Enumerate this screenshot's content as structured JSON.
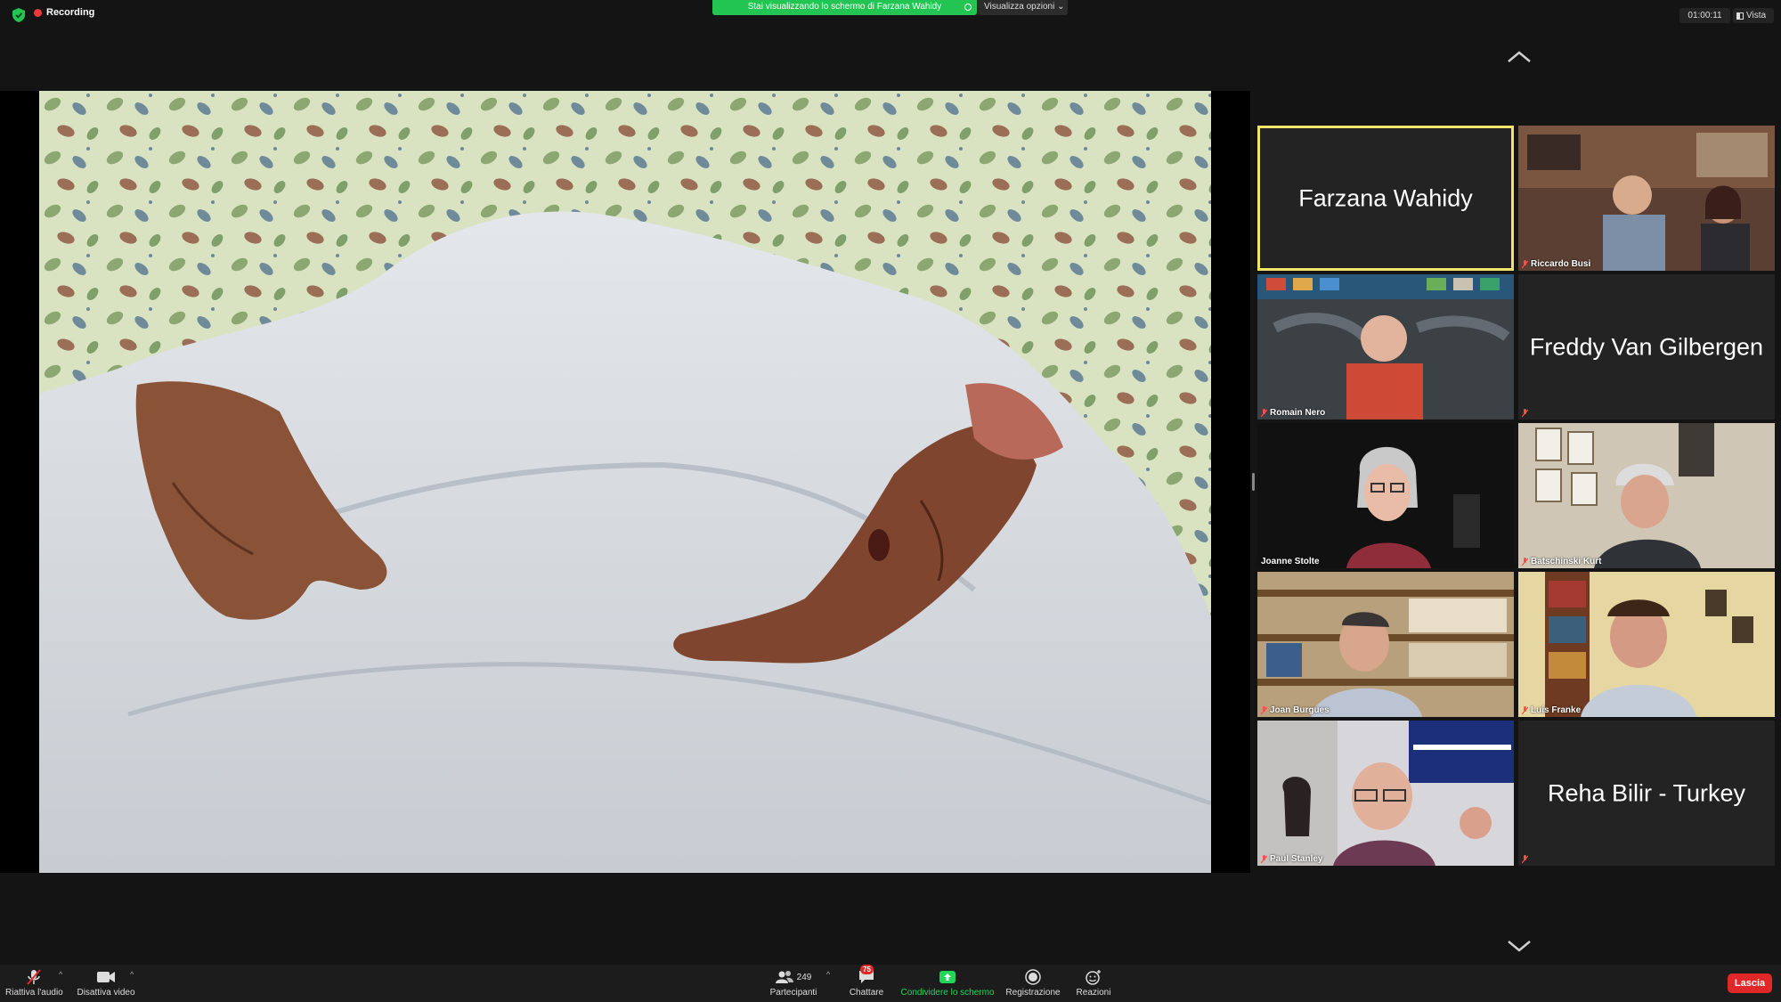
{
  "topbar": {
    "recording_label": "Recording",
    "share_banner": "Stai visualizzando lo schermo di Farzana Wahidy",
    "view_options": "Visualizza opzioni",
    "timer": "01:00:11",
    "view_label": "Vista"
  },
  "gallery": {
    "tiles": [
      {
        "name": "Farzana Wahidy",
        "display": "big-name",
        "active": true
      },
      {
        "name": "Riccardo Busi",
        "display": "video"
      },
      {
        "name": "Romain Nero",
        "display": "video"
      },
      {
        "name": "Freddy Van Gilbergen",
        "display": "big-name"
      },
      {
        "name": "Joanne Stolte",
        "display": "video"
      },
      {
        "name": "Batschinski Kurt",
        "display": "video"
      },
      {
        "name": "Joan Burgues",
        "display": "video"
      },
      {
        "name": "Luis Franke",
        "display": "video"
      },
      {
        "name": "Paul Stanley",
        "display": "video"
      },
      {
        "name": "Reha Bilir - Turkey",
        "display": "big-name"
      }
    ]
  },
  "toolbar": {
    "audio_label": "Riattiva l'audio",
    "video_label": "Disattiva video",
    "participants_label": "Partecipanti",
    "participants_count": "249",
    "chat_label": "Chattare",
    "chat_badge": "75",
    "share_label": "Condividere lo schermo",
    "record_label": "Registrazione",
    "reactions_label": "Reazioni",
    "leave_label": "Lascia"
  },
  "colors": {
    "share_green": "#23c552",
    "active_border": "#f2e36a",
    "leave_red": "#e02828",
    "record_red": "#f0373c"
  }
}
